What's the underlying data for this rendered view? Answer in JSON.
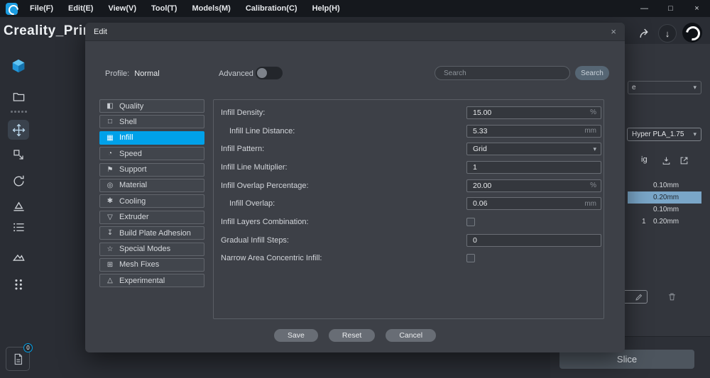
{
  "colors": {
    "accent": "#00a1e9",
    "titlebar-bg": "#15181d",
    "app-bg": "#2a2d34",
    "panel-bg": "#33363d",
    "dialog-bg": "#3d4047",
    "highlight-row": "#7aa6c8",
    "slice-bg": "#4d555e",
    "logo-blue": "#1b9ce0"
  },
  "titlebar": {
    "menus": [
      "File(F)",
      "Edit(E)",
      "View(V)",
      "Tool(T)",
      "Models(M)",
      "Calibration(C)",
      "Help(H)"
    ],
    "minimize": "—",
    "maximize": "□",
    "close": "×"
  },
  "app": {
    "title": "Creality_Prin"
  },
  "sidebar": {
    "badge_count": "0"
  },
  "right_panel": {
    "top_dropdown_text": "e",
    "material_value": "Hyper PLA_1.75",
    "config_title_fragment": "ig",
    "rows": [
      {
        "value": "0.10mm"
      },
      {
        "value": "0.20mm"
      },
      {
        "value": "0.10mm"
      },
      {
        "prefix": "1",
        "value": "0.20mm"
      }
    ],
    "slice_label": "Slice"
  },
  "dialog": {
    "title": "Edit",
    "close": "×",
    "profile_label": "Profile:",
    "profile_value": "Normal",
    "advanced_label": "Advanced",
    "search_placeholder": "Search",
    "search_button_label": "Search",
    "categories": [
      {
        "icon": "◧",
        "label": "Quality"
      },
      {
        "icon": "□",
        "label": "Shell"
      },
      {
        "icon": "▦",
        "label": "Infill"
      },
      {
        "icon": "◔",
        "label": "Speed"
      },
      {
        "icon": "⚑",
        "label": "Support"
      },
      {
        "icon": "◎",
        "label": "Material"
      },
      {
        "icon": "✱",
        "label": "Cooling"
      },
      {
        "icon": "▽",
        "label": "Extruder"
      },
      {
        "icon": "↧",
        "label": "Build Plate Adhesion"
      },
      {
        "icon": "☆",
        "label": "Special Modes"
      },
      {
        "icon": "⊞",
        "label": "Mesh Fixes"
      },
      {
        "icon": "△",
        "label": "Experimental"
      }
    ],
    "settings": [
      {
        "label": "Infill Density:",
        "value": "15.00",
        "unit": "%"
      },
      {
        "label": "Infill Line Distance:",
        "value": "5.33",
        "unit": "mm"
      },
      {
        "label": "Infill Pattern:",
        "value": "Grid"
      },
      {
        "label": "Infill Line Multiplier:",
        "value": "1"
      },
      {
        "label": "Infill Overlap Percentage:",
        "value": "20.00",
        "unit": "%"
      },
      {
        "label": "Infill Overlap:",
        "value": "0.06",
        "unit": "mm"
      },
      {
        "label": "Infill Layers Combination:"
      },
      {
        "label": "Gradual Infill Steps:",
        "value": "0"
      },
      {
        "label": "Narrow Area Concentric Infill:"
      }
    ],
    "save_label": "Save",
    "reset_label": "Reset",
    "cancel_label": "Cancel"
  }
}
